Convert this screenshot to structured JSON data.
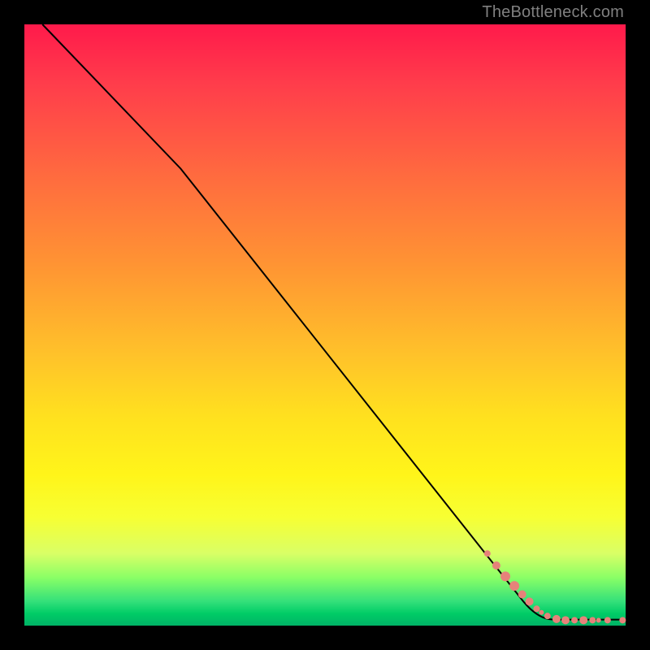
{
  "attribution": "TheBottleneck.com",
  "colors": {
    "dot": "#e6827a",
    "curve": "#000000",
    "frame": "#000000"
  },
  "chart_data": {
    "type": "line",
    "title": "",
    "xlabel": "",
    "ylabel": "",
    "xlim": [
      0,
      100
    ],
    "ylim": [
      0,
      100
    ],
    "grid": false,
    "legend": false,
    "series": [
      {
        "name": "bottleneck-curve",
        "type": "line",
        "points": [
          {
            "x": 3,
            "y": 100
          },
          {
            "x": 26,
            "y": 76
          },
          {
            "x": 83,
            "y": 4
          },
          {
            "x": 88,
            "y": 1
          },
          {
            "x": 100,
            "y": 1
          }
        ]
      },
      {
        "name": "data-points",
        "type": "scatter",
        "points": [
          {
            "x": 77,
            "y": 12,
            "r": 4
          },
          {
            "x": 78.5,
            "y": 10,
            "r": 5
          },
          {
            "x": 80,
            "y": 8.2,
            "r": 6
          },
          {
            "x": 81.5,
            "y": 6.6,
            "r": 6
          },
          {
            "x": 82.8,
            "y": 5.2,
            "r": 5
          },
          {
            "x": 84,
            "y": 4.0,
            "r": 5
          },
          {
            "x": 85.2,
            "y": 2.8,
            "r": 4
          },
          {
            "x": 86,
            "y": 2.2,
            "r": 3
          },
          {
            "x": 87,
            "y": 1.6,
            "r": 4
          },
          {
            "x": 88.5,
            "y": 1.1,
            "r": 5
          },
          {
            "x": 90,
            "y": 0.9,
            "r": 5
          },
          {
            "x": 91.5,
            "y": 0.9,
            "r": 4
          },
          {
            "x": 93,
            "y": 0.9,
            "r": 5
          },
          {
            "x": 94.5,
            "y": 0.9,
            "r": 4
          },
          {
            "x": 95.5,
            "y": 0.9,
            "r": 3
          },
          {
            "x": 97,
            "y": 0.9,
            "r": 4
          },
          {
            "x": 99.5,
            "y": 0.9,
            "r": 4
          }
        ]
      }
    ]
  }
}
